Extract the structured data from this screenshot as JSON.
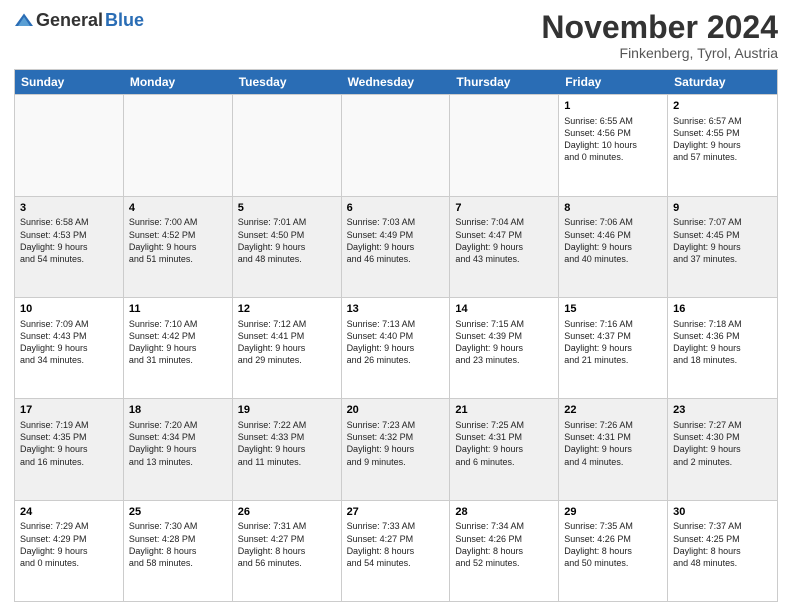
{
  "logo": {
    "general": "General",
    "blue": "Blue"
  },
  "title": "November 2024",
  "location": "Finkenberg, Tyrol, Austria",
  "header": {
    "days": [
      "Sunday",
      "Monday",
      "Tuesday",
      "Wednesday",
      "Thursday",
      "Friday",
      "Saturday"
    ]
  },
  "rows": [
    {
      "cells": [
        {
          "day": "",
          "content": "",
          "empty": true
        },
        {
          "day": "",
          "content": "",
          "empty": true
        },
        {
          "day": "",
          "content": "",
          "empty": true
        },
        {
          "day": "",
          "content": "",
          "empty": true
        },
        {
          "day": "",
          "content": "",
          "empty": true
        },
        {
          "day": "1",
          "content": "Sunrise: 6:55 AM\nSunset: 4:56 PM\nDaylight: 10 hours\nand 0 minutes.",
          "empty": false
        },
        {
          "day": "2",
          "content": "Sunrise: 6:57 AM\nSunset: 4:55 PM\nDaylight: 9 hours\nand 57 minutes.",
          "empty": false
        }
      ]
    },
    {
      "cells": [
        {
          "day": "3",
          "content": "Sunrise: 6:58 AM\nSunset: 4:53 PM\nDaylight: 9 hours\nand 54 minutes.",
          "empty": false
        },
        {
          "day": "4",
          "content": "Sunrise: 7:00 AM\nSunset: 4:52 PM\nDaylight: 9 hours\nand 51 minutes.",
          "empty": false
        },
        {
          "day": "5",
          "content": "Sunrise: 7:01 AM\nSunset: 4:50 PM\nDaylight: 9 hours\nand 48 minutes.",
          "empty": false
        },
        {
          "day": "6",
          "content": "Sunrise: 7:03 AM\nSunset: 4:49 PM\nDaylight: 9 hours\nand 46 minutes.",
          "empty": false
        },
        {
          "day": "7",
          "content": "Sunrise: 7:04 AM\nSunset: 4:47 PM\nDaylight: 9 hours\nand 43 minutes.",
          "empty": false
        },
        {
          "day": "8",
          "content": "Sunrise: 7:06 AM\nSunset: 4:46 PM\nDaylight: 9 hours\nand 40 minutes.",
          "empty": false
        },
        {
          "day": "9",
          "content": "Sunrise: 7:07 AM\nSunset: 4:45 PM\nDaylight: 9 hours\nand 37 minutes.",
          "empty": false
        }
      ]
    },
    {
      "cells": [
        {
          "day": "10",
          "content": "Sunrise: 7:09 AM\nSunset: 4:43 PM\nDaylight: 9 hours\nand 34 minutes.",
          "empty": false
        },
        {
          "day": "11",
          "content": "Sunrise: 7:10 AM\nSunset: 4:42 PM\nDaylight: 9 hours\nand 31 minutes.",
          "empty": false
        },
        {
          "day": "12",
          "content": "Sunrise: 7:12 AM\nSunset: 4:41 PM\nDaylight: 9 hours\nand 29 minutes.",
          "empty": false
        },
        {
          "day": "13",
          "content": "Sunrise: 7:13 AM\nSunset: 4:40 PM\nDaylight: 9 hours\nand 26 minutes.",
          "empty": false
        },
        {
          "day": "14",
          "content": "Sunrise: 7:15 AM\nSunset: 4:39 PM\nDaylight: 9 hours\nand 23 minutes.",
          "empty": false
        },
        {
          "day": "15",
          "content": "Sunrise: 7:16 AM\nSunset: 4:37 PM\nDaylight: 9 hours\nand 21 minutes.",
          "empty": false
        },
        {
          "day": "16",
          "content": "Sunrise: 7:18 AM\nSunset: 4:36 PM\nDaylight: 9 hours\nand 18 minutes.",
          "empty": false
        }
      ]
    },
    {
      "cells": [
        {
          "day": "17",
          "content": "Sunrise: 7:19 AM\nSunset: 4:35 PM\nDaylight: 9 hours\nand 16 minutes.",
          "empty": false
        },
        {
          "day": "18",
          "content": "Sunrise: 7:20 AM\nSunset: 4:34 PM\nDaylight: 9 hours\nand 13 minutes.",
          "empty": false
        },
        {
          "day": "19",
          "content": "Sunrise: 7:22 AM\nSunset: 4:33 PM\nDaylight: 9 hours\nand 11 minutes.",
          "empty": false
        },
        {
          "day": "20",
          "content": "Sunrise: 7:23 AM\nSunset: 4:32 PM\nDaylight: 9 hours\nand 9 minutes.",
          "empty": false
        },
        {
          "day": "21",
          "content": "Sunrise: 7:25 AM\nSunset: 4:31 PM\nDaylight: 9 hours\nand 6 minutes.",
          "empty": false
        },
        {
          "day": "22",
          "content": "Sunrise: 7:26 AM\nSunset: 4:31 PM\nDaylight: 9 hours\nand 4 minutes.",
          "empty": false
        },
        {
          "day": "23",
          "content": "Sunrise: 7:27 AM\nSunset: 4:30 PM\nDaylight: 9 hours\nand 2 minutes.",
          "empty": false
        }
      ]
    },
    {
      "cells": [
        {
          "day": "24",
          "content": "Sunrise: 7:29 AM\nSunset: 4:29 PM\nDaylight: 9 hours\nand 0 minutes.",
          "empty": false
        },
        {
          "day": "25",
          "content": "Sunrise: 7:30 AM\nSunset: 4:28 PM\nDaylight: 8 hours\nand 58 minutes.",
          "empty": false
        },
        {
          "day": "26",
          "content": "Sunrise: 7:31 AM\nSunset: 4:27 PM\nDaylight: 8 hours\nand 56 minutes.",
          "empty": false
        },
        {
          "day": "27",
          "content": "Sunrise: 7:33 AM\nSunset: 4:27 PM\nDaylight: 8 hours\nand 54 minutes.",
          "empty": false
        },
        {
          "day": "28",
          "content": "Sunrise: 7:34 AM\nSunset: 4:26 PM\nDaylight: 8 hours\nand 52 minutes.",
          "empty": false
        },
        {
          "day": "29",
          "content": "Sunrise: 7:35 AM\nSunset: 4:26 PM\nDaylight: 8 hours\nand 50 minutes.",
          "empty": false
        },
        {
          "day": "30",
          "content": "Sunrise: 7:37 AM\nSunset: 4:25 PM\nDaylight: 8 hours\nand 48 minutes.",
          "empty": false
        }
      ]
    }
  ]
}
